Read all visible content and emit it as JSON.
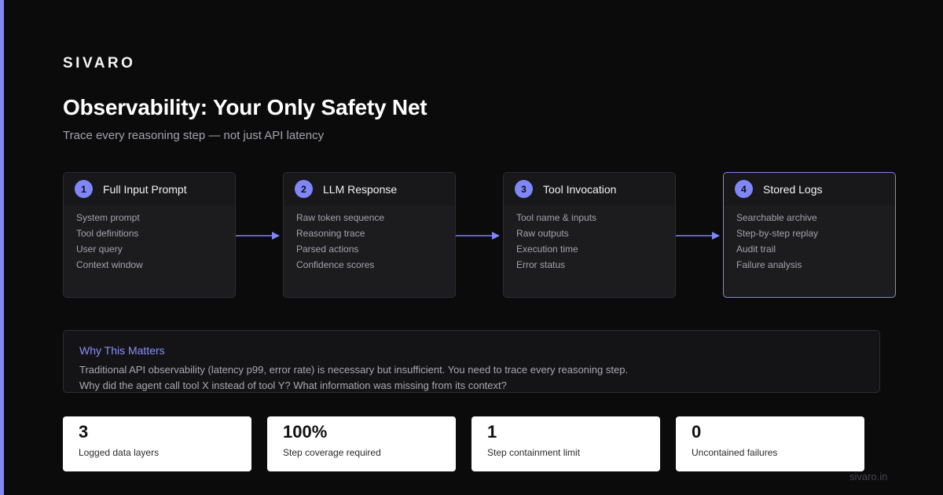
{
  "brand": "SIVARO",
  "title": "Observability: Your Only Safety Net",
  "subtitle": "Trace every reasoning step — not just API latency",
  "colors": {
    "accent": "#7f86f5",
    "background": "#0b0b0c",
    "card": "#1c1c1f",
    "stat_card": "#ffffff"
  },
  "steps": [
    {
      "number": "1",
      "title": "Full Input Prompt",
      "items": [
        "System prompt",
        "Tool definitions",
        "User query",
        "Context window"
      ]
    },
    {
      "number": "2",
      "title": "LLM Response",
      "items": [
        "Raw token sequence",
        "Reasoning trace",
        "Parsed actions",
        "Confidence scores"
      ]
    },
    {
      "number": "3",
      "title": "Tool Invocation",
      "items": [
        "Tool name & inputs",
        "Raw outputs",
        "Execution time",
        "Error status"
      ]
    },
    {
      "number": "4",
      "title": "Stored Logs",
      "items": [
        "Searchable archive",
        "Step-by-step replay",
        "Audit trail",
        "Failure analysis"
      ]
    }
  ],
  "why": {
    "title": "Why This Matters",
    "line1": "Traditional API observability (latency p99, error rate) is necessary but insufficient. You need to trace every reasoning step.",
    "line2": "Why did the agent call tool X instead of tool Y? What information was missing from its context?"
  },
  "stats": [
    {
      "value": "3",
      "label": "Logged data layers"
    },
    {
      "value": "100%",
      "label": "Step coverage required"
    },
    {
      "value": "1",
      "label": "Step containment limit"
    },
    {
      "value": "0",
      "label": "Uncontained failures"
    }
  ],
  "footer": "sivaro.in"
}
